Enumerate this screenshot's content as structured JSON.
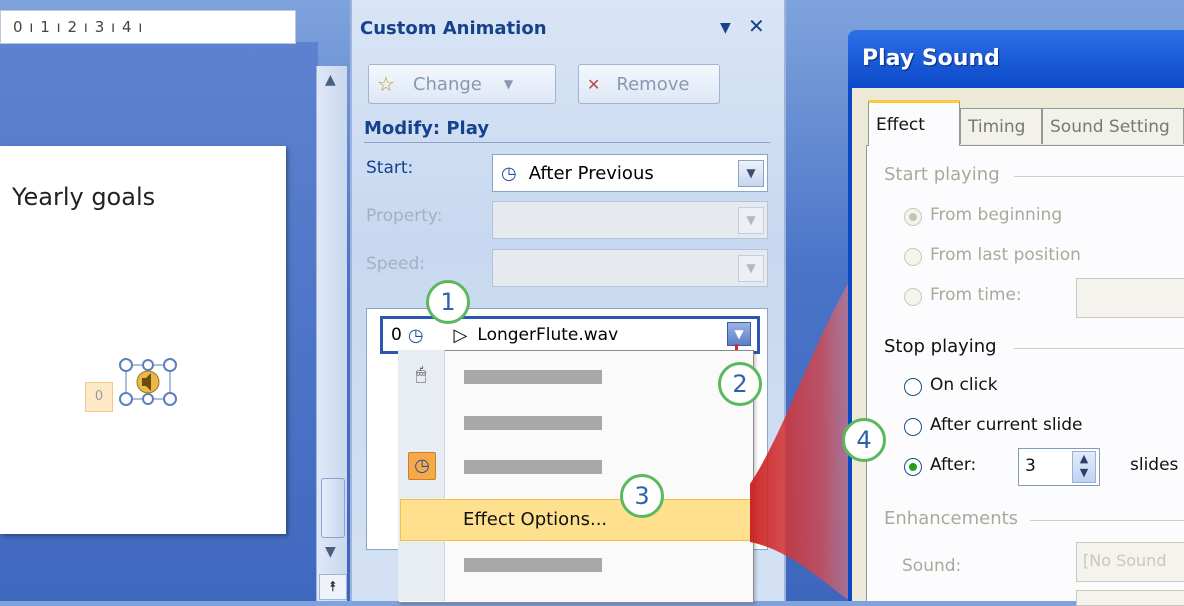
{
  "ruler": {
    "text": "0 ı 1 ı 2 ı 3 ı 4 ı"
  },
  "slide": {
    "title": "Yearly goals",
    "animation_tag": "0"
  },
  "task_pane": {
    "title": "Custom Animation",
    "change_label": "Change",
    "remove_label": "Remove",
    "modify_label": "Modify: Play",
    "start_label": "Start:",
    "start_value": "After Previous",
    "property_label": "Property:",
    "speed_label": "Speed:",
    "animation_item": {
      "order": "0",
      "name": "LongerFlute.wav"
    },
    "menu_effect_options": "Effect Options..."
  },
  "callouts": [
    "1",
    "2",
    "3",
    "4"
  ],
  "dialog": {
    "title": "Play Sound",
    "tabs": [
      "Effect",
      "Timing",
      "Sound Setting"
    ],
    "start_playing_label": "Start playing",
    "start_options": [
      "From beginning",
      "From last position",
      "From time:"
    ],
    "stop_playing_label": "Stop playing",
    "stop_options": [
      "On click",
      "After current slide",
      "After:"
    ],
    "after_value": "3",
    "slides_label": "slides",
    "enhancements_label": "Enhancements",
    "sound_label": "Sound:",
    "sound_value": "[No Sound"
  },
  "colors": {
    "accent_red": "#d42a2a",
    "callout_ring": "#5cb85c",
    "title_blue": "#15428b",
    "dialog_title_bar": "#0a48c8"
  }
}
